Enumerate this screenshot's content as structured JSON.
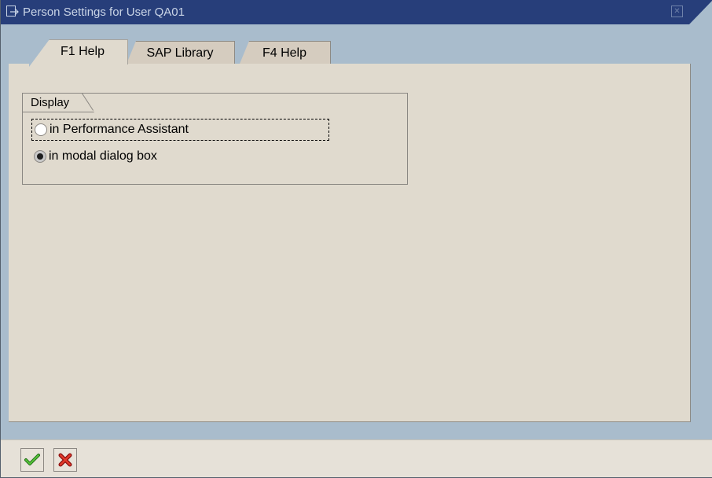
{
  "window": {
    "title": "Person Settings for User QA01",
    "colors": {
      "titlebar": "#273e7a",
      "frame": "#a9bccc",
      "panel": "#e0dace",
      "accent_check": "#2f8f1f",
      "accent_cancel": "#cc1b1b"
    }
  },
  "tabs": [
    {
      "label": "F1 Help",
      "active": true
    },
    {
      "label": "SAP Library",
      "active": false
    },
    {
      "label": "F4 Help",
      "active": false
    }
  ],
  "group": {
    "title": "Display",
    "options": [
      {
        "label": "in Performance Assistant",
        "selected": false,
        "focused": true
      },
      {
        "label": "in modal dialog box",
        "selected": true,
        "focused": false
      }
    ]
  },
  "footer": {
    "buttons": [
      {
        "name": "confirm",
        "icon": "checkmark-icon"
      },
      {
        "name": "cancel",
        "icon": "cancel-x-icon"
      }
    ]
  }
}
